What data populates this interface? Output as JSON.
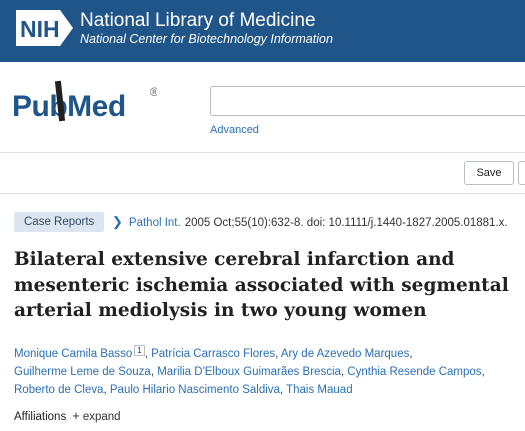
{
  "nih": {
    "logo_text": "NIH",
    "title": "National Library of Medicine",
    "subtitle": "National Center for Biotechnology Information"
  },
  "pubmed": {
    "logo_text": "PubMed",
    "registered_mark": "®"
  },
  "search": {
    "value": "",
    "advanced_label": "Advanced"
  },
  "toolbar": {
    "save_label": "Save"
  },
  "article": {
    "publication_type": "Case Reports",
    "journal": "Pathol Int.",
    "citation": "2005 Oct;55(10):632-8. doi: 10.1111/j.1440-1827.2005.01881.x.",
    "title": "Bilateral extensive cerebral infarction and mesenteric ischemia associated with segmental arterial mediolysis in two young women",
    "authors": [
      "Monique Camila Basso",
      "Patrícia Carrasco Flores",
      "Ary de Azevedo Marques",
      "Guilherme Leme de Souza",
      "Marilia D'Elboux Guimarães Brescia",
      "Cynthia Resende Campos",
      "Roberto de Cleva",
      "Paulo Hilario Nascimento Saldiva",
      "Thais Mauad"
    ],
    "first_author_affiliation_ref": "1",
    "affiliations_label": "Affiliations",
    "expand_label": "expand"
  },
  "colors": {
    "nih_blue": "#20558a",
    "link_blue": "#2a6fb5",
    "badge_bg": "#dce6f2"
  }
}
